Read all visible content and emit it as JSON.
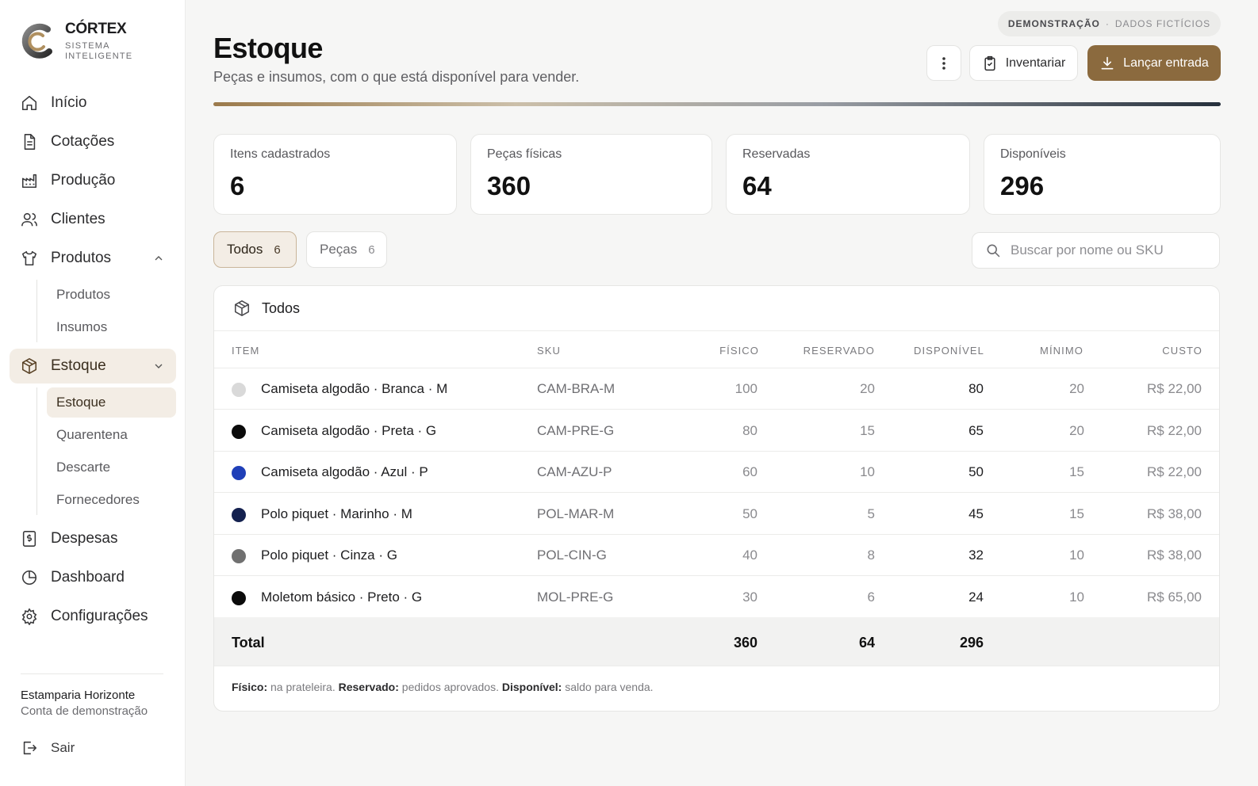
{
  "brand": {
    "name": "CÓRTEX",
    "subtitle": "SISTEMA INTELIGENTE",
    "accent": "#8b6a3e"
  },
  "sidebar": {
    "items": [
      {
        "label": "Início",
        "icon": "home-icon"
      },
      {
        "label": "Cotações",
        "icon": "document-icon"
      },
      {
        "label": "Produção",
        "icon": "factory-icon"
      },
      {
        "label": "Clientes",
        "icon": "users-icon"
      },
      {
        "label": "Produtos",
        "icon": "shirt-icon",
        "expanded": true,
        "children": [
          "Produtos",
          "Insumos"
        ]
      },
      {
        "label": "Estoque",
        "icon": "box-icon",
        "expanded": true,
        "active": true,
        "children": [
          "Estoque",
          "Quarentena",
          "Descarte",
          "Fornecedores"
        ]
      },
      {
        "label": "Despesas",
        "icon": "receipt-icon"
      },
      {
        "label": "Dashboard",
        "icon": "pie-chart-icon"
      },
      {
        "label": "Configurações",
        "icon": "gear-icon"
      }
    ],
    "org_name": "Estamparia Horizonte",
    "org_sub": "Conta de demonstração",
    "logout": "Sair"
  },
  "demo_pill": {
    "main": "DEMONSTRAÇÃO",
    "sep": "·",
    "sub": "DADOS FICTÍCIOS"
  },
  "header": {
    "title": "Estoque",
    "subtitle": "Peças e insumos, com o que está disponível para vender.",
    "inventory_label": "Inventariar",
    "entry_label": "Lançar entrada"
  },
  "stats": [
    {
      "label": "Itens cadastrados",
      "value": "6"
    },
    {
      "label": "Peças físicas",
      "value": "360"
    },
    {
      "label": "Reservadas",
      "value": "64"
    },
    {
      "label": "Disponíveis",
      "value": "296"
    }
  ],
  "filters": [
    {
      "label": "Todos",
      "count": "6",
      "active": true
    },
    {
      "label": "Peças",
      "count": "6",
      "active": false
    }
  ],
  "search": {
    "placeholder": "Buscar por nome ou SKU"
  },
  "table": {
    "title": "Todos",
    "columns": [
      "ITEM",
      "SKU",
      "FÍSICO",
      "RESERVADO",
      "DISPONÍVEL",
      "MÍNIMO",
      "CUSTO"
    ],
    "rows": [
      {
        "color": "#d9d9d9",
        "item": "Camiseta algodão · Branca · M",
        "sku": "CAM-BRA-M",
        "fisico": "100",
        "reservado": "20",
        "disponivel": "80",
        "minimo": "20",
        "custo": "R$ 22,00"
      },
      {
        "color": "#0b0b0b",
        "item": "Camiseta algodão · Preta · G",
        "sku": "CAM-PRE-G",
        "fisico": "80",
        "reservado": "15",
        "disponivel": "65",
        "minimo": "20",
        "custo": "R$ 22,00"
      },
      {
        "color": "#1f3fb8",
        "item": "Camiseta algodão · Azul · P",
        "sku": "CAM-AZU-P",
        "fisico": "60",
        "reservado": "10",
        "disponivel": "50",
        "minimo": "15",
        "custo": "R$ 22,00"
      },
      {
        "color": "#14214f",
        "item": "Polo piquet · Marinho · M",
        "sku": "POL-MAR-M",
        "fisico": "50",
        "reservado": "5",
        "disponivel": "45",
        "minimo": "15",
        "custo": "R$ 38,00"
      },
      {
        "color": "#707070",
        "item": "Polo piquet · Cinza · G",
        "sku": "POL-CIN-G",
        "fisico": "40",
        "reservado": "8",
        "disponivel": "32",
        "minimo": "10",
        "custo": "R$ 38,00"
      },
      {
        "color": "#0b0b0b",
        "item": "Moletom básico · Preto · G",
        "sku": "MOL-PRE-G",
        "fisico": "30",
        "reservado": "6",
        "disponivel": "24",
        "minimo": "10",
        "custo": "R$ 65,00"
      }
    ],
    "total": {
      "label": "Total",
      "fisico": "360",
      "reservado": "64",
      "disponivel": "296"
    },
    "legend": {
      "k1": "Físico:",
      "v1": " na prateleira.",
      "k2": " Reservado:",
      "v2": " pedidos aprovados.",
      "k3": " Disponível:",
      "v3": " saldo para venda."
    }
  }
}
